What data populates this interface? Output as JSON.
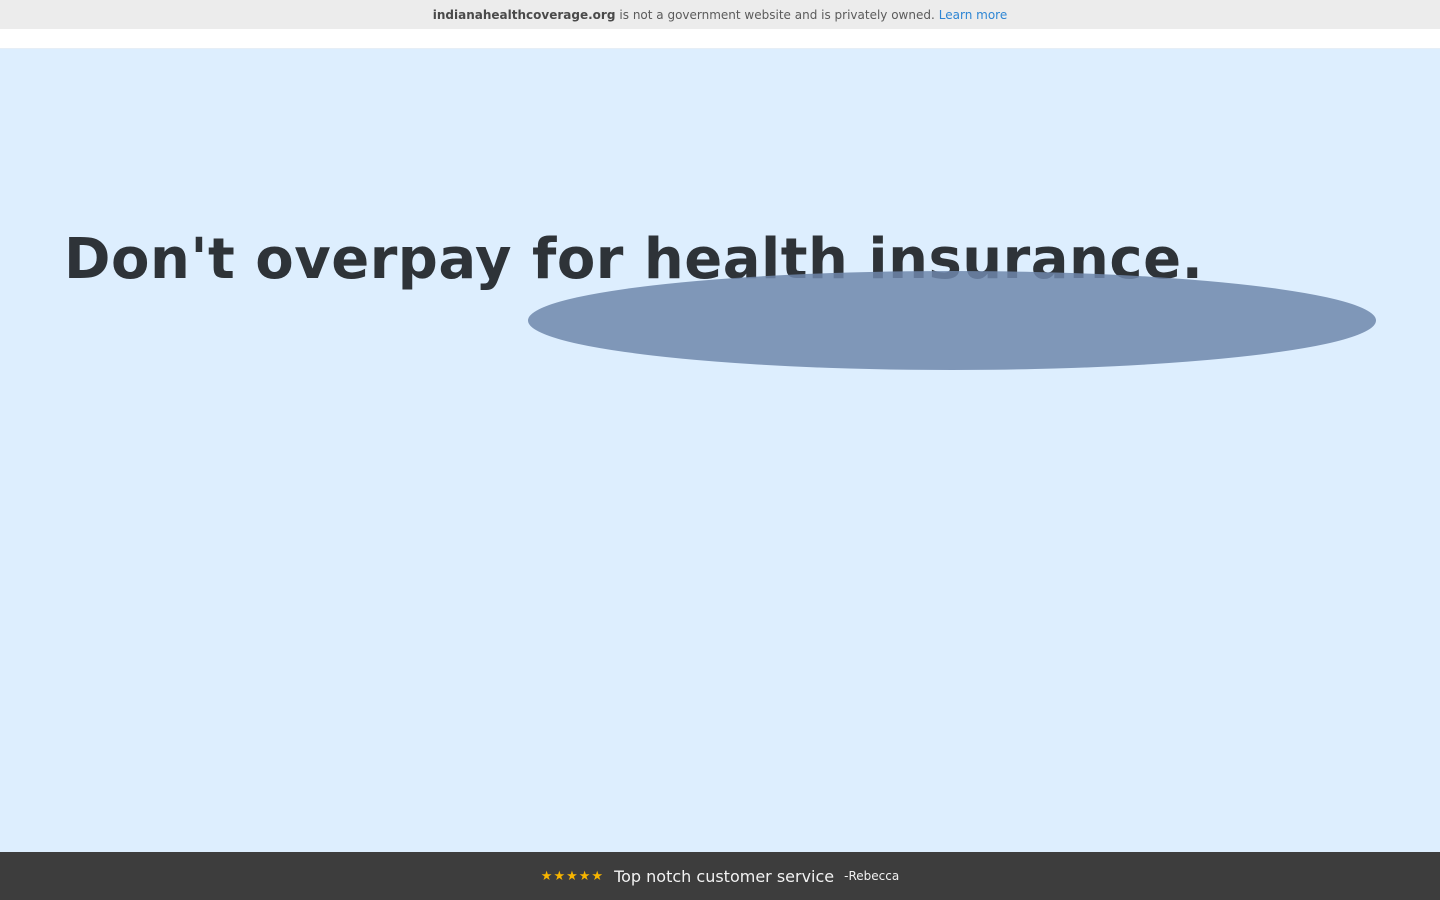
{
  "disclaimer": {
    "site": "indianahealthcoverage.org",
    "message": "is not a government website and is privately owned.",
    "link_label": "Learn more"
  },
  "hero": {
    "title": "Don't overpay for health insurance."
  },
  "review": {
    "stars": "★★★★★",
    "rating": 5,
    "quote": "Top notch customer service",
    "author": "-Rebecca"
  },
  "colors": {
    "hero_background": "#ddeefe",
    "review_bar": "#3d3d3d",
    "star": "#f7b500",
    "link": "#2e86d4"
  }
}
